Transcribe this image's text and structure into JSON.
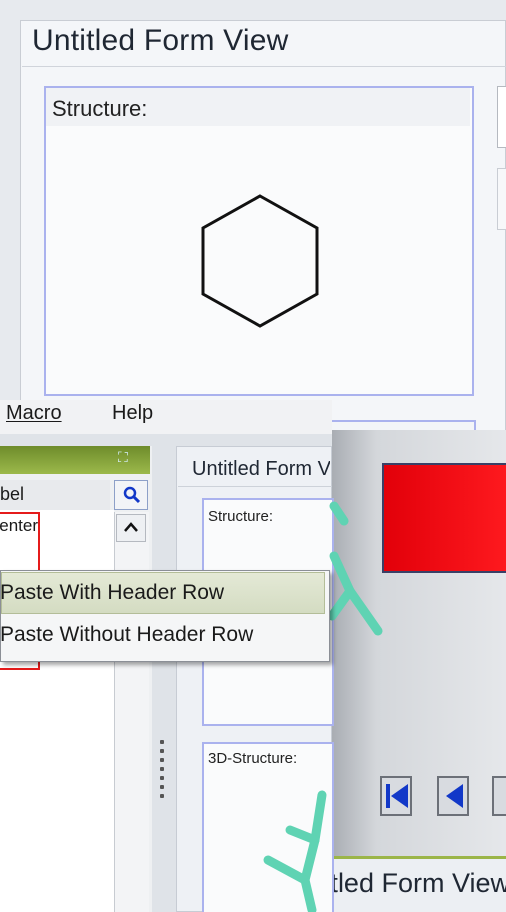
{
  "back_window": {
    "title": "Untitled Form View",
    "structure_label": "Structure:"
  },
  "front_app": {
    "menu": [
      "Macro",
      "Help"
    ],
    "list_panel": {
      "column_label": "bel",
      "cell_text": "enter"
    },
    "form_view": {
      "title": "Untitled Form View",
      "structure_label": "Structure:",
      "structure3d_label": "3D-Structure:"
    }
  },
  "context_menu": {
    "items": [
      "Paste With Header Row",
      "Paste Without Header Row"
    ]
  },
  "bottom_window": {
    "title": "Untitled Form View"
  },
  "colors": {
    "accent_green": "#9cb94b",
    "field_border": "#aab2ee",
    "red_box": "#ff0000",
    "molecule": "#5fd3b3"
  },
  "icons": [
    "search-icon",
    "scroll-up-icon",
    "expand-icon",
    "first-record-icon",
    "previous-record-icon"
  ]
}
